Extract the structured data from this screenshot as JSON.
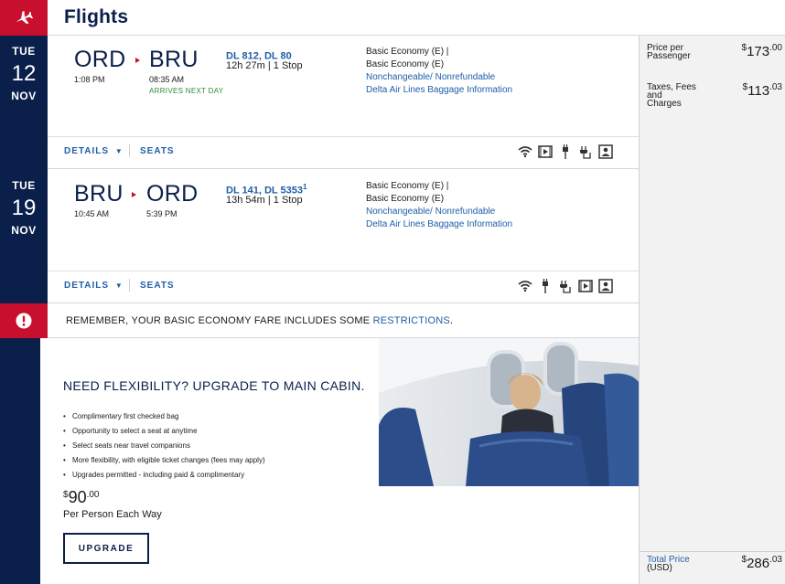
{
  "header": {
    "title": "Flights",
    "logo_icon": "plane-icon"
  },
  "colors": {
    "brand_red": "#c8102e",
    "navy": "#0b1f4b",
    "link_blue": "#1f5ea8",
    "green": "#2e8b3a"
  },
  "flights": [
    {
      "date": {
        "dow": "TUE",
        "day": "12",
        "month": "NOV"
      },
      "origin": {
        "code": "ORD",
        "time": "1:08 PM"
      },
      "destination": {
        "code": "BRU",
        "time": "08:35 AM"
      },
      "arrives_note": "ARRIVES NEXT DAY",
      "flight_numbers": "DL 812, DL 80",
      "flight_sup": "",
      "duration": "12h 27m | 1 Stop",
      "fare_line1": "Basic Economy (E) |",
      "fare_line2": "Basic Economy (E)",
      "fare_link1": "Nonchangeable/ Nonrefundable",
      "fare_link2": "Delta Air Lines Baggage Information",
      "details_label": "DETAILS",
      "seats_label": "SEATS",
      "amenities": [
        "wifi-icon",
        "video-icon",
        "power-icon",
        "plug-icon",
        "seatback-screen-icon"
      ]
    },
    {
      "date": {
        "dow": "TUE",
        "day": "19",
        "month": "NOV"
      },
      "origin": {
        "code": "BRU",
        "time": "10:45 AM"
      },
      "destination": {
        "code": "ORD",
        "time": "5:39 PM"
      },
      "arrives_note": "",
      "flight_numbers": "DL 141, DL 5353",
      "flight_sup": "1",
      "duration": "13h 54m | 1 Stop",
      "fare_line1": "Basic Economy (E) |",
      "fare_line2": "Basic Economy (E)",
      "fare_link1": "Nonchangeable/ Nonrefundable",
      "fare_link2": "Delta Air Lines Baggage Information",
      "details_label": "DETAILS",
      "seats_label": "SEATS",
      "amenities": [
        "wifi-icon",
        "power-icon",
        "plug-icon",
        "video-icon",
        "seatback-screen-icon"
      ]
    }
  ],
  "alert": {
    "text": "REMEMBER, YOUR BASIC ECONOMY FARE INCLUDES SOME ",
    "link": "RESTRICTIONS",
    "end": "."
  },
  "upsell": {
    "title": "NEED FLEXIBILITY? UPGRADE TO MAIN CABIN.",
    "bullets": [
      "Complimentary first checked bag",
      "Opportunity to select a seat at anytime",
      "Select seats near travel companions",
      "More flexibility, with eligible ticket changes (fees may apply)",
      "Upgrades permitted - including paid & complimentary"
    ],
    "price_currency": "$",
    "price_whole": "90",
    "price_cents": ".00",
    "price_note": "Per Person Each Way",
    "button": "UPGRADE"
  },
  "summary": {
    "price_label": "Price per Passenger",
    "price_currency": "$",
    "price_whole": "173",
    "price_cents": ".00",
    "taxes_label": "Taxes, Fees and Charges",
    "taxes_currency": "$",
    "taxes_whole": "113",
    "taxes_cents": ".03",
    "total_label": "Total Price",
    "total_sub": "(USD)",
    "total_currency": "$",
    "total_whole": "286",
    "total_cents": ".03"
  }
}
